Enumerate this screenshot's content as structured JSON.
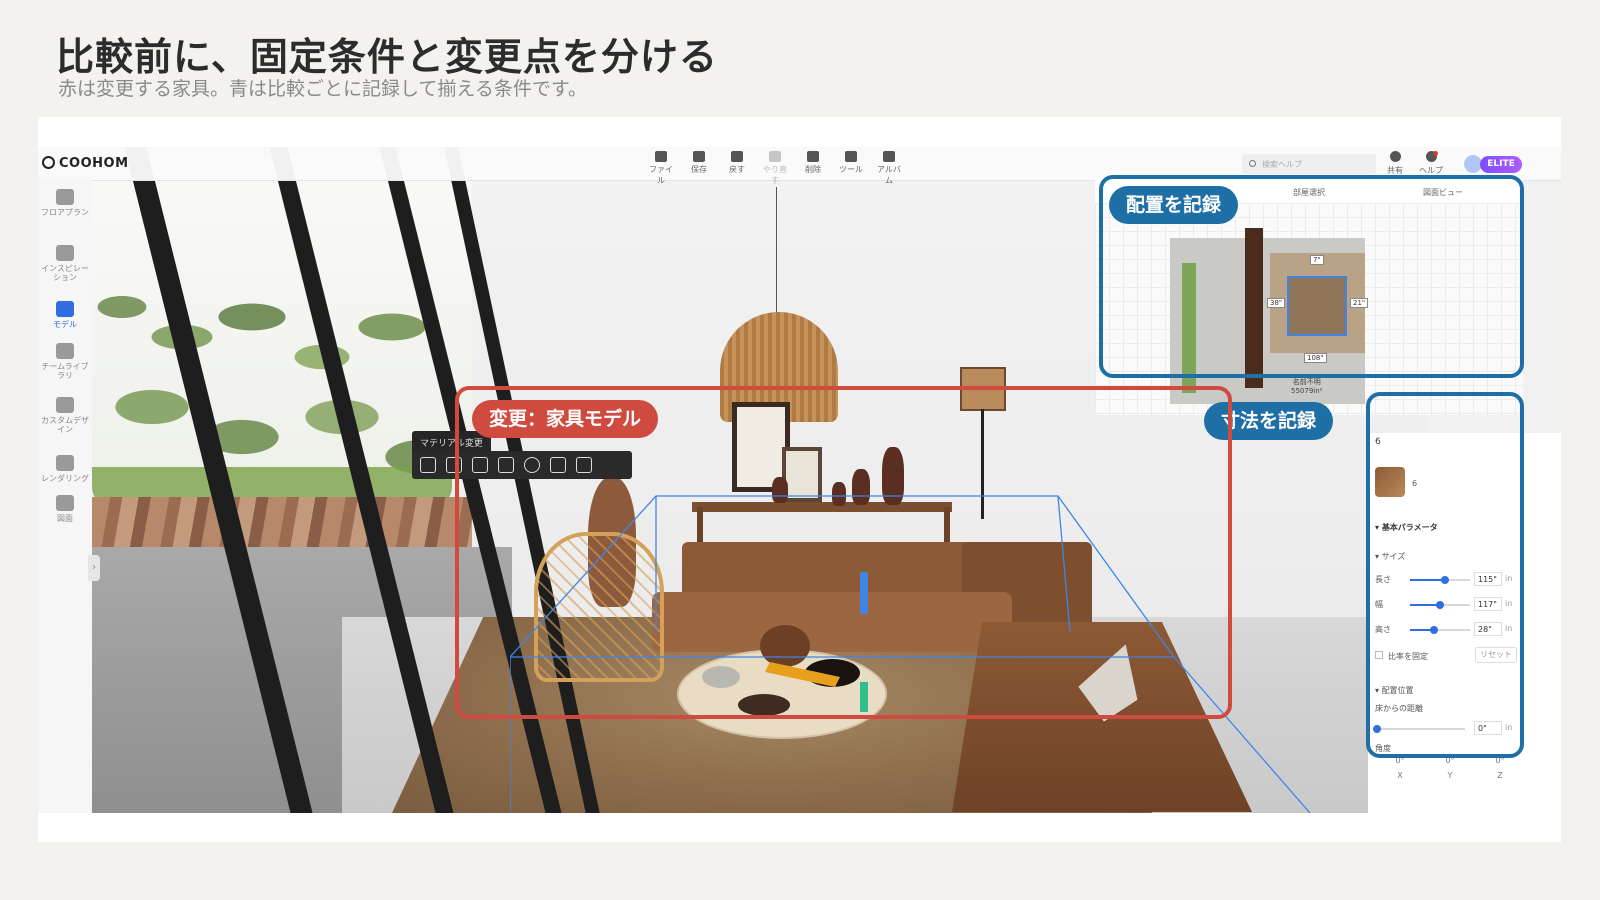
{
  "slide": {
    "title": "比較前に、固定条件と変更点を分ける",
    "subtitle": "赤は変更する家具。青は比較ごとに記録して揃える条件です。"
  },
  "colors": {
    "annotation_red": "#cf4b3f",
    "annotation_blue": "#1f6fa7",
    "app_accent": "#2f6de0",
    "selection_box": "#3f85e8"
  },
  "app": {
    "logo": "COOHOM",
    "toolbar": [
      {
        "label": "ファイル",
        "icon": "file-icon",
        "disabled": false
      },
      {
        "label": "保存",
        "icon": "save-icon",
        "disabled": false
      },
      {
        "label": "戻す",
        "icon": "undo-icon",
        "disabled": false
      },
      {
        "label": "やり直す",
        "icon": "redo-icon",
        "disabled": true
      },
      {
        "label": "削除",
        "icon": "eraser-icon",
        "disabled": false
      },
      {
        "label": "ツール",
        "icon": "wrench-icon",
        "disabled": false
      },
      {
        "label": "アルバム",
        "icon": "album-icon",
        "disabled": false
      }
    ],
    "search_placeholder": "検索ヘルプ",
    "share_label": "共有",
    "help_label": "ヘルプ",
    "badge": "ELITE",
    "left_nav": [
      {
        "label": "フロアプラン",
        "icon": "floorplan-icon",
        "active": false
      },
      {
        "label": "インスピレーション",
        "icon": "bulb-icon",
        "active": false
      },
      {
        "label": "モデル",
        "icon": "sofa-icon",
        "active": true
      },
      {
        "label": "チームライブラリ",
        "icon": "crown-icon",
        "active": false
      },
      {
        "label": "カスタムデザイン",
        "icon": "custom-design-icon",
        "active": false
      },
      {
        "label": "レンダリング",
        "icon": "camera-icon",
        "active": false
      },
      {
        "label": "図面",
        "icon": "drawing-icon",
        "active": false
      }
    ],
    "collapse_glyph": "›",
    "floating": {
      "tag": "マテリアル変更"
    },
    "minimap": {
      "tab_room": "部屋選択",
      "tab_view": "図面ビュー",
      "dims": {
        "top": "7\"",
        "left": "38\"",
        "right": "21\"",
        "bottom": "108\""
      },
      "room_name": "名前不明",
      "room_area": "55079in²"
    },
    "props": {
      "header": "6",
      "item_name": "6",
      "section_basic": "基本パラメータ",
      "section_size": "サイズ",
      "length_label": "長さ",
      "length_value": "115\"",
      "length_fill": 0.58,
      "width_label": "幅",
      "width_value": "117\"",
      "width_fill": 0.5,
      "height_label": "高さ",
      "height_value": "28\"",
      "height_fill": 0.4,
      "unit": "in",
      "lock_ratio": "比率を固定",
      "reset": "リセット",
      "section_position": "配置位置",
      "floor_distance": "床からの距離",
      "floor_value": "0\"",
      "angle_label": "角度",
      "angle_x": "0°",
      "angle_y": "0°",
      "angle_z": "0°",
      "axis_x": "X",
      "axis_y": "Y",
      "axis_z": "Z"
    }
  },
  "annotations": {
    "placement": "配置を記録",
    "dimensions": "寸法を記録",
    "change": "変更：家具モデル"
  }
}
